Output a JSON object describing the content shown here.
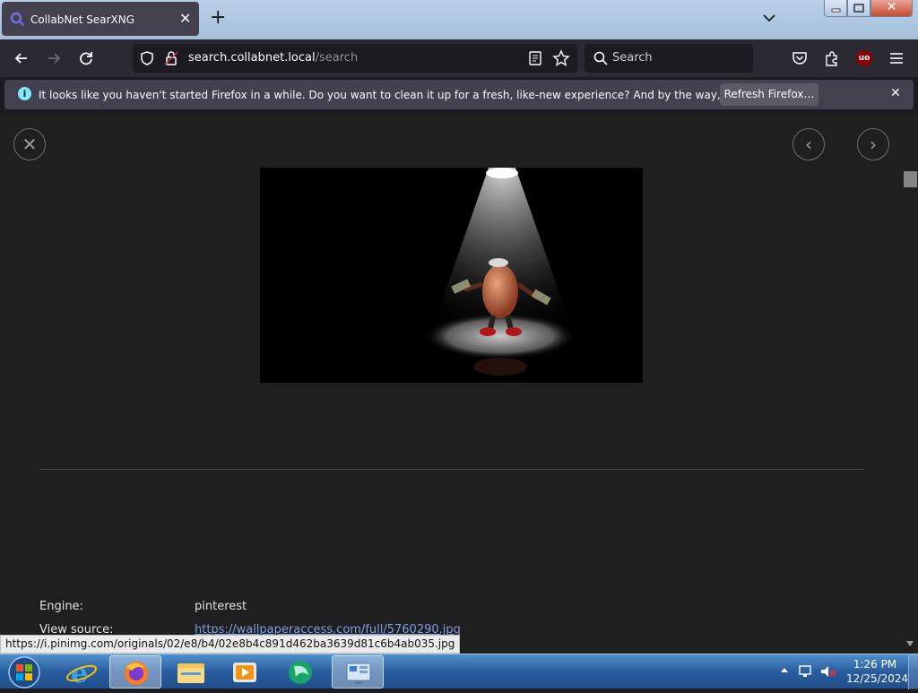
{
  "browser": {
    "tab_title": "CollabNet SearXNG",
    "url_host": "search.collabnet.local",
    "url_path": "/search",
    "search_placeholder": "Search",
    "extension_badge": "uo"
  },
  "notification": {
    "message": "It looks like you haven't started Firefox in a while. Do you want to clean it up for a fresh, like-new experience? And by the way, welcome back!",
    "button_label": "Refresh Firefox…"
  },
  "details": {
    "engine_label": "Engine:",
    "engine_value": "pinterest",
    "source_label": "View source:",
    "source_value": "https://wallpaperaccess.com/full/5760290.jpg"
  },
  "status_url": "https://i.pinimg.com/originals/02/e8/b4/02e8b4c891d462ba3639d81c6b4ab035.jpg",
  "taskbar": {
    "time": "1:26 PM",
    "date": "12/25/2024"
  },
  "colors": {
    "accent": "#80ebff",
    "link": "#7e9ee0",
    "page_bg": "#1f1f1f"
  }
}
